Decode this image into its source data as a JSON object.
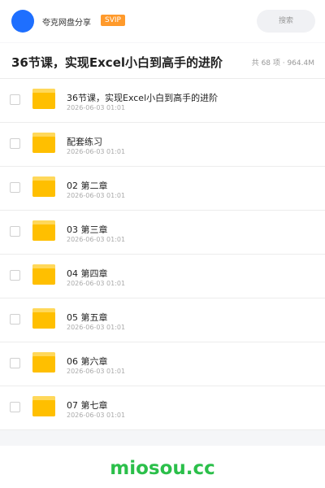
{
  "header": {
    "username": "夸克网盘分享",
    "badge": "SVIP",
    "search_placeholder": "搜索"
  },
  "folder": {
    "title": "36节课，实现Excel小白到高手的进阶",
    "meta": "共 68 项 · 964.4M"
  },
  "items": [
    {
      "name": "36节课，实现Excel小白到高手的进阶",
      "date": "2026-06-03 01:01",
      "icon": "folder-icon"
    },
    {
      "name": "配套练习",
      "date": "2026-06-03 01:01",
      "icon": "folder-icon"
    },
    {
      "name": "02 第二章",
      "date": "2026-06-03 01:01",
      "icon": "folder-icon"
    },
    {
      "name": "03 第三章",
      "date": "2026-06-03 01:01",
      "icon": "folder-icon"
    },
    {
      "name": "04 第四章",
      "date": "2026-06-03 01:01",
      "icon": "folder-icon"
    },
    {
      "name": "05 第五章",
      "date": "2026-06-03 01:01",
      "icon": "folder-icon"
    },
    {
      "name": "06 第六章",
      "date": "2026-06-03 01:01",
      "icon": "folder-icon"
    },
    {
      "name": "07 第七章",
      "date": "2026-06-03 01:01",
      "icon": "folder-icon"
    }
  ],
  "footer": {
    "watermark": "miosou.cc"
  },
  "colors": {
    "accent": "#1e6fff",
    "badge": "#ff9a2b",
    "folder": "#ffbf00",
    "watermark": "#2bbf4a"
  }
}
